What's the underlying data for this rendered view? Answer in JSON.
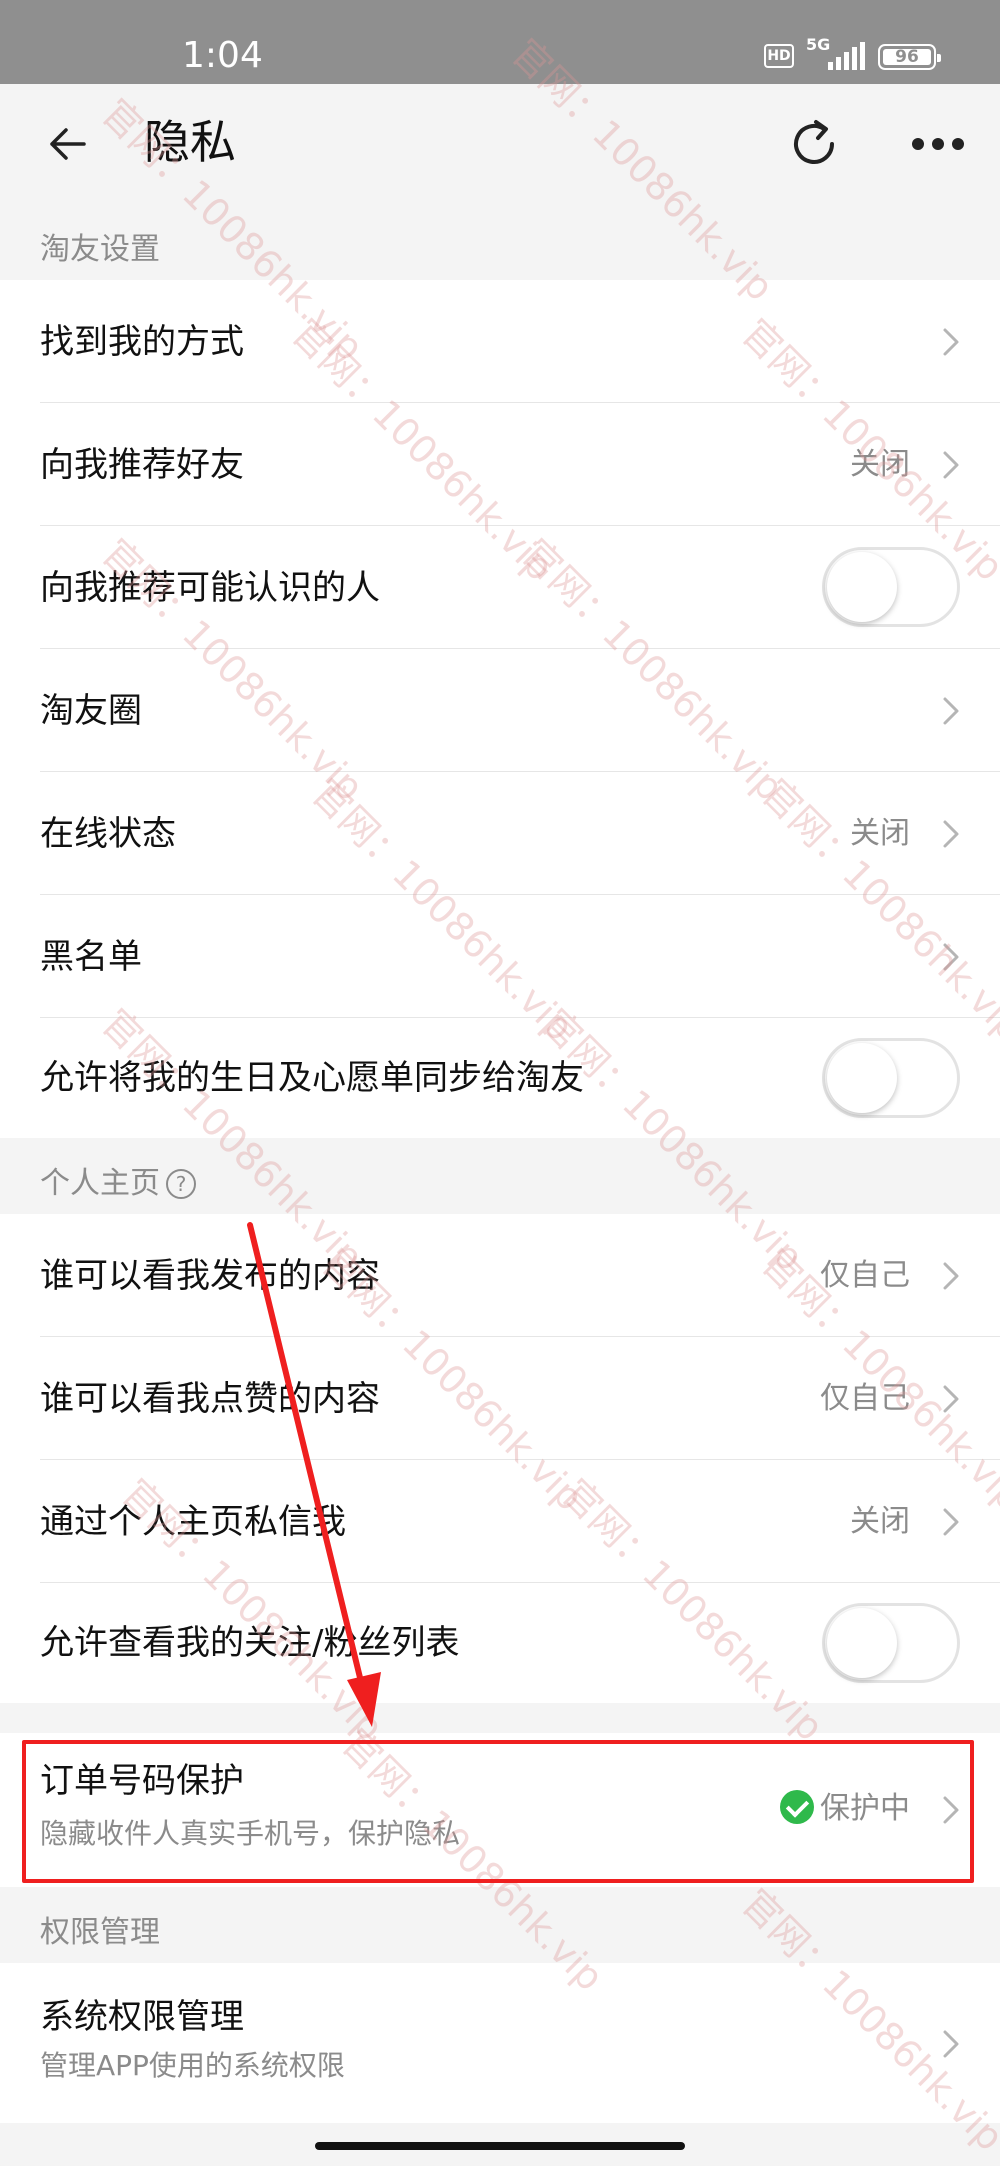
{
  "status_bar": {
    "time": "1:04",
    "hd_badge": "HD",
    "network": "5G",
    "battery": "96"
  },
  "header": {
    "title": "隐私",
    "back_icon": "arrow-left-icon",
    "refresh_icon": "refresh-icon",
    "more_icon": "more-horizontal-icon"
  },
  "sections": {
    "taoyou_settings": {
      "title": "淘友设置",
      "items": [
        {
          "label": "找到我的方式",
          "value": ""
        },
        {
          "label": "向我推荐好友",
          "value": "关闭"
        },
        {
          "label": "向我推荐可能认识的人",
          "toggle": false
        },
        {
          "label": "淘友圈",
          "value": ""
        },
        {
          "label": "在线状态",
          "value": "关闭"
        },
        {
          "label": "黑名单",
          "value": ""
        },
        {
          "label": "允许将我的生日及心愿单同步给淘友",
          "toggle": false
        }
      ]
    },
    "personal_home": {
      "title": "个人主页",
      "help_icon_glyph": "?",
      "items": [
        {
          "label": "谁可以看我发布的内容",
          "value": "仅自己"
        },
        {
          "label": "谁可以看我点赞的内容",
          "value": "仅自己"
        },
        {
          "label": "通过个人主页私信我",
          "value": "关闭"
        },
        {
          "label": "允许查看我的关注/粉丝列表",
          "toggle": false
        }
      ]
    },
    "order_protection": {
      "label": "订单号码保护",
      "sub": "隐藏收件人真实手机号，保护隐私",
      "status": "保护中",
      "status_color": "#2fb94b"
    },
    "permission_mgmt": {
      "title": "权限管理",
      "items": [
        {
          "label": "系统权限管理",
          "sub": "管理APP使用的系统权限"
        }
      ]
    }
  },
  "watermark_text": "官网：10086hk.vip",
  "annotation": {
    "box_color": "#ef1f1f",
    "arrow_color": "#ef1f1f"
  }
}
